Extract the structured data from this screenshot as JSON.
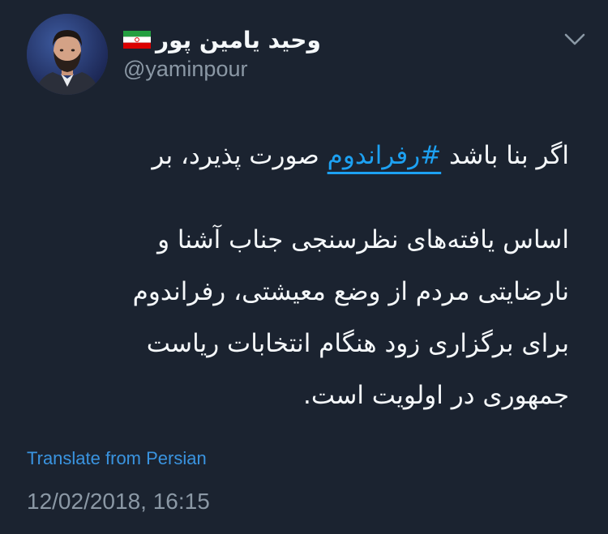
{
  "user": {
    "display_name": "وحید یامین پور",
    "handle": "@yaminpour",
    "flag_icon": "iran-flag-icon",
    "avatar_icon": "profile-photo"
  },
  "menu": {
    "icon": "chevron-down-icon"
  },
  "tweet": {
    "line1_prefix": "اگر بنا باشد ",
    "hashtag": "#رفراندوم",
    "line1_suffix": " صورت پذیرد، بر",
    "line2": "اساس یافته‌های نظرسنجی جناب آشنا و",
    "line3": "نارضایتی مردم از وضع معیشتی، رفراندوم",
    "line4": "برای برگزاری زود هنگام انتخابات ریاست",
    "line5": "جمهوری در اولویت است."
  },
  "translate": {
    "label": "Translate from Persian"
  },
  "meta": {
    "timestamp": "12/02/2018, 16:15"
  },
  "colors": {
    "background": "#1b2330",
    "text": "#f5f8fa",
    "secondary": "#8b98a5",
    "link": "#1da1f2"
  }
}
